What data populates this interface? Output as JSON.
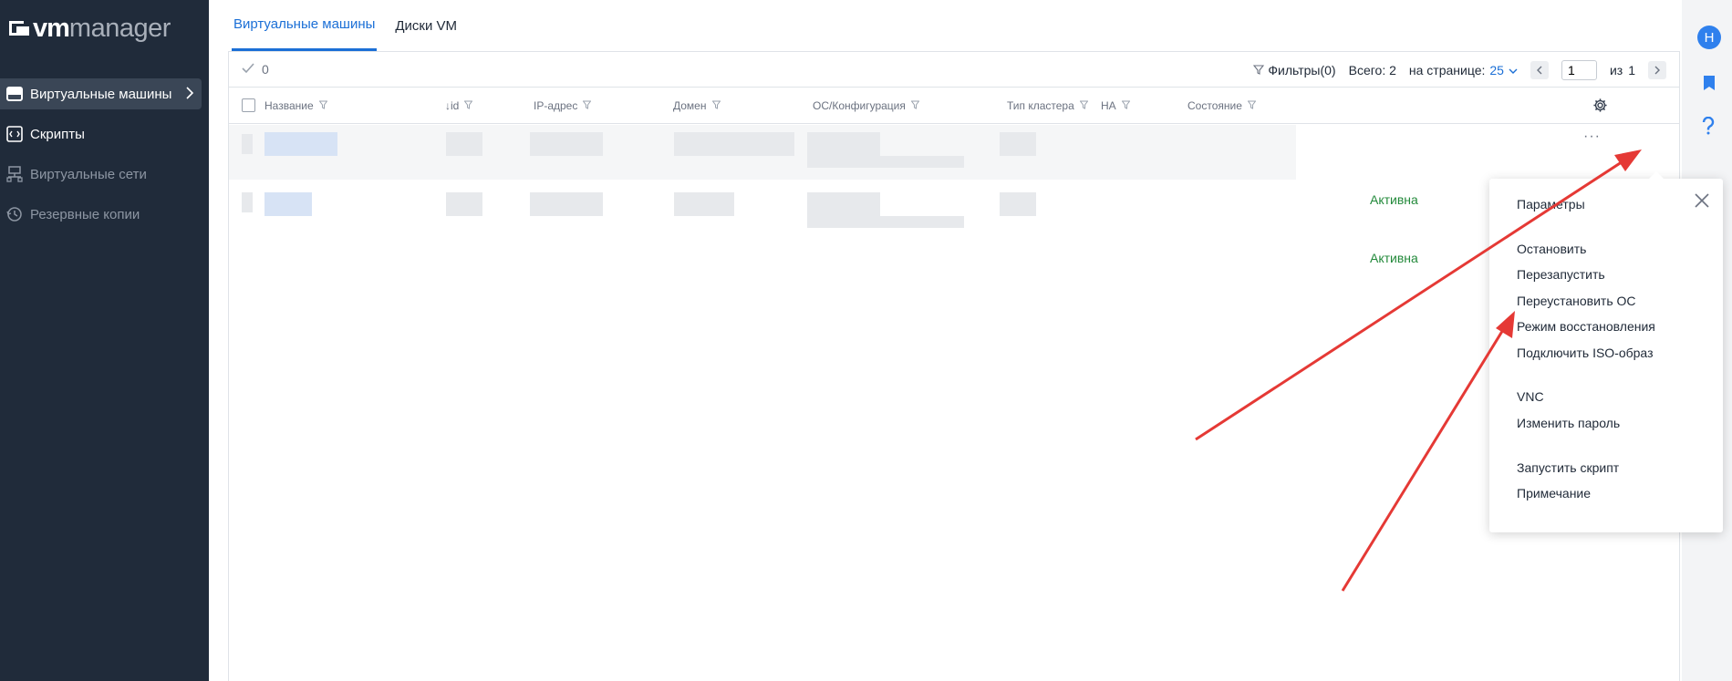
{
  "app": {
    "logo_vm": "vm",
    "logo_manager": "manager",
    "user_initial": "Н"
  },
  "sidebar": {
    "items": [
      {
        "label": "Виртуальные машины",
        "icon": "server-icon",
        "active": true
      },
      {
        "label": "Скрипты",
        "icon": "script-icon",
        "active": false
      },
      {
        "label": "Виртуальные сети",
        "icon": "network-icon",
        "active": false
      },
      {
        "label": "Резервные копии",
        "icon": "backup-icon",
        "active": false
      }
    ]
  },
  "tabs": [
    {
      "label": "Виртуальные машины",
      "active": true
    },
    {
      "label": "Диски VM",
      "active": false
    }
  ],
  "toolbar": {
    "selected_count": "0",
    "filters_label": "Фильтры(0)",
    "total_label": "Всего: 2",
    "per_page_label": "на странице:",
    "per_page_value": "25",
    "page_value": "1",
    "of_label": "из",
    "total_pages": "1"
  },
  "table": {
    "columns": [
      "Название",
      "↓id",
      "IP-адрес",
      "Домен",
      "ОС/Конфигурация",
      "Тип кластера",
      "HA",
      "Состояние"
    ],
    "rows": [
      {
        "status": "Активна"
      },
      {
        "status": "Активна"
      }
    ],
    "row_menu_glyph": "···"
  },
  "context_menu": {
    "items": [
      "Параметры",
      "Остановить",
      "Перезапустить",
      "Переустановить ОС",
      "Режим восстановления",
      "Подключить ISO-образ",
      "VNC",
      "Изменить пароль",
      "Запустить скрипт",
      "Примечание"
    ]
  },
  "colors": {
    "sidebar_bg": "#202b3a",
    "accent": "#1b6fd6",
    "status_active": "#22893a",
    "annotation_arrow": "#e53935"
  }
}
